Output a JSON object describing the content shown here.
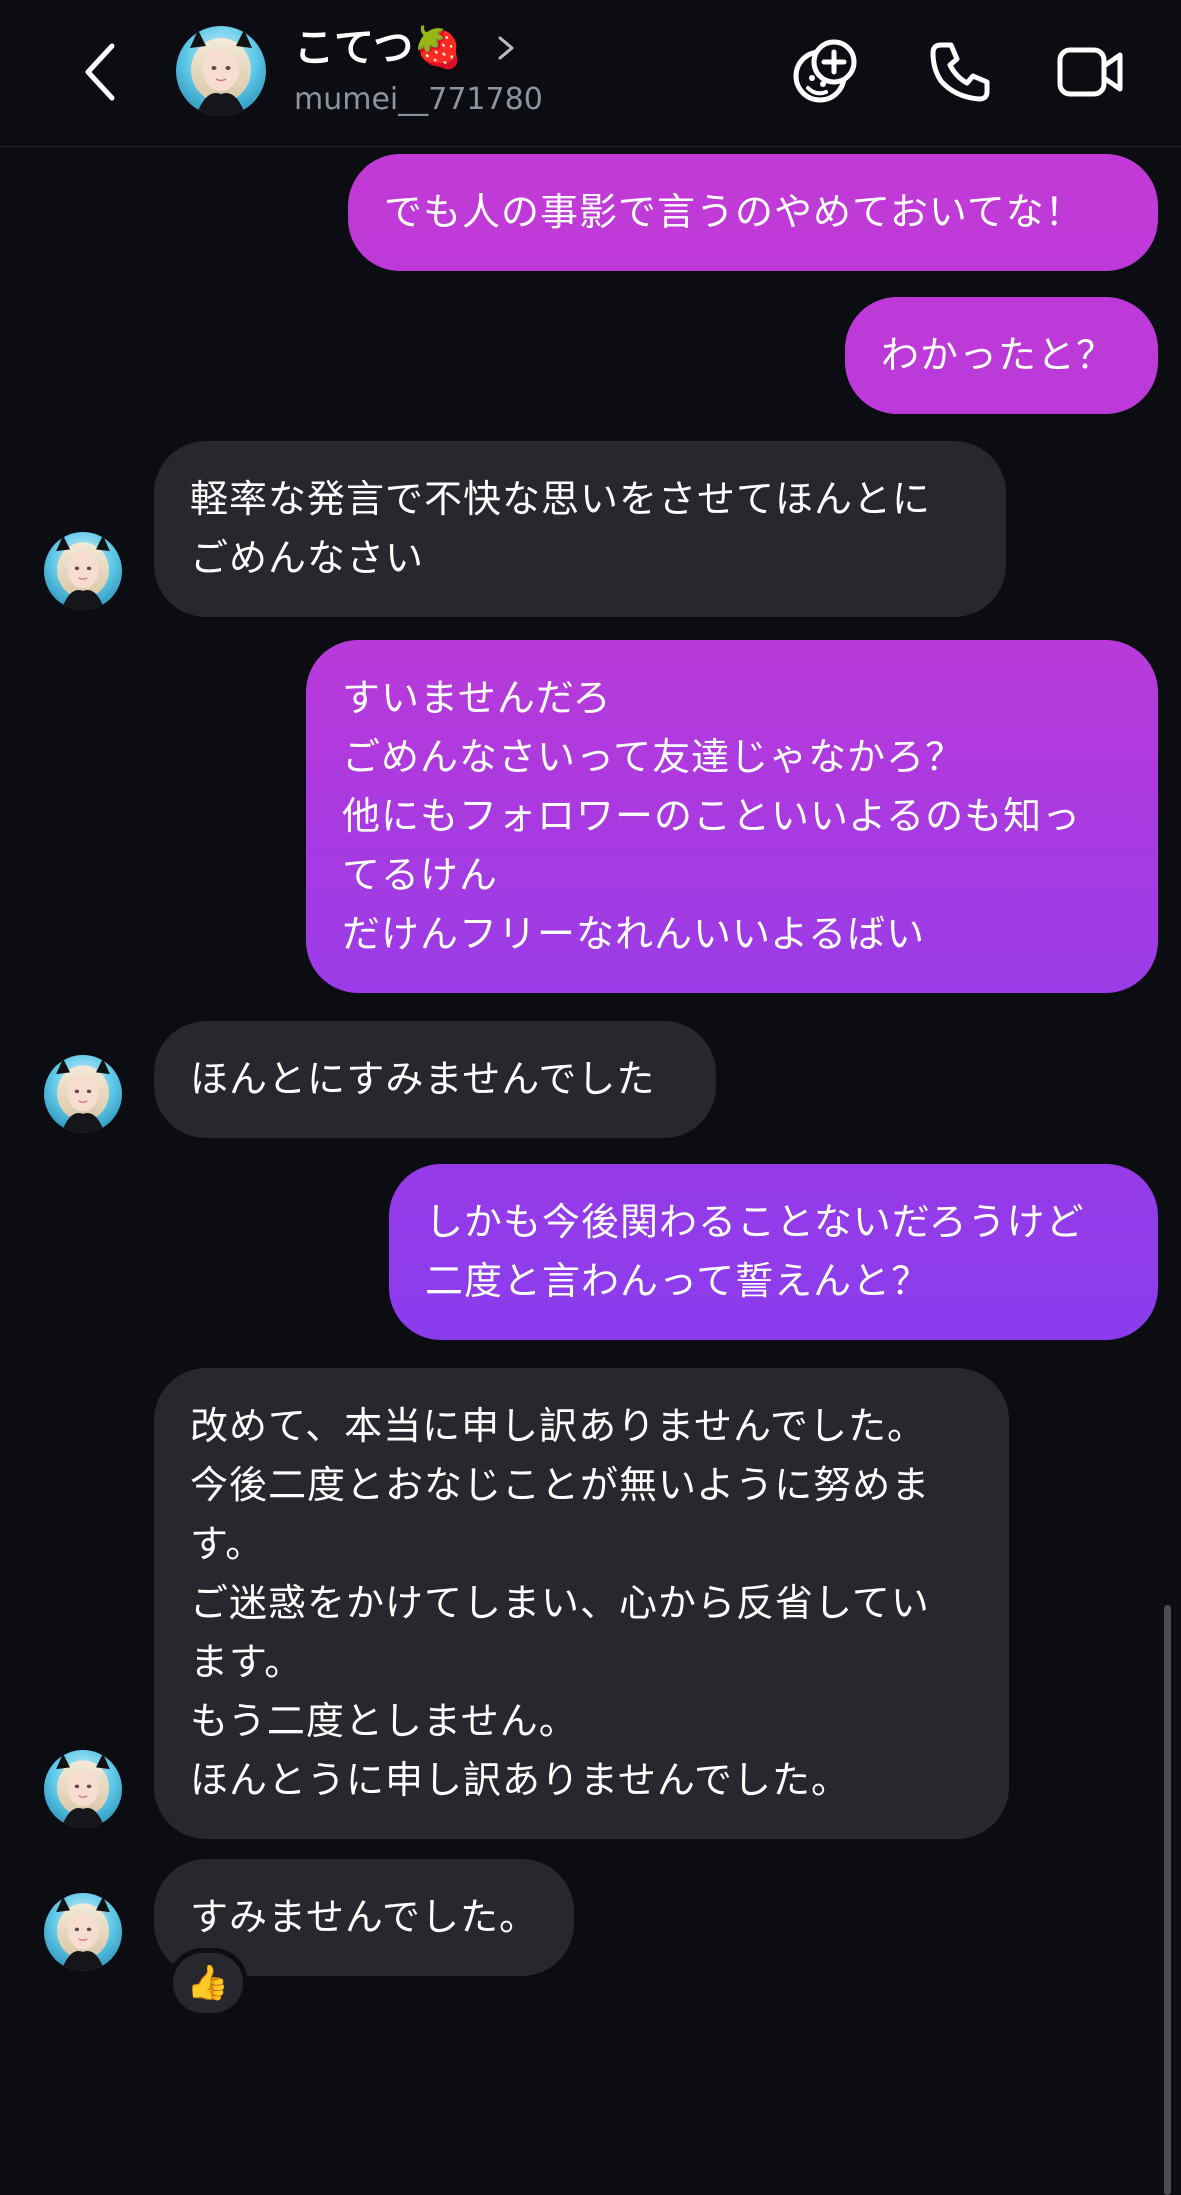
{
  "header": {
    "contact_name": "こてつ🍓",
    "handle": "mumei__771780",
    "back_icon": "chevron-left",
    "effects_icon": "face-plus-sparkle",
    "call_icon": "phone",
    "video_icon": "video-camera"
  },
  "messages": [
    {
      "dir": "sent",
      "text": "でも人の事影で言うのやめておいてな！"
    },
    {
      "dir": "sent",
      "text": "わかったと？"
    },
    {
      "dir": "recv",
      "text": "軽率な発言で不快な思いをさせてほんとに\nごめんなさい"
    },
    {
      "dir": "sent",
      "text": "すいませんだろ\nごめんなさいって友達じゃなかろ？\n他にもフォロワーのこといいよるのも知っ\nてるけん\nだけんフリーなれんいいよるばい"
    },
    {
      "dir": "recv",
      "text": "ほんとにすみませんでした"
    },
    {
      "dir": "sent",
      "text": "しかも今後関わることないだろうけど\n二度と言わんって誓えんと？"
    },
    {
      "dir": "recv",
      "text": "改めて、本当に申し訳ありませんでした。\n今後二度とおなじことが無いように努めま\nす。\nご迷惑をかけてしまい、心から反省してい\nます。\nもう二度としません。\nほんとうに申し訳ありませんでした。"
    },
    {
      "dir": "recv",
      "text": "すみませんでした。"
    }
  ],
  "reaction": {
    "emoji": "👍"
  },
  "colors": {
    "background": "#0b0d12",
    "received_bubble": "#26282d",
    "sent_gradient_top": "#c23ad6",
    "sent_gradient_bottom": "#7a3cf4",
    "handle_text": "#8e939c"
  }
}
